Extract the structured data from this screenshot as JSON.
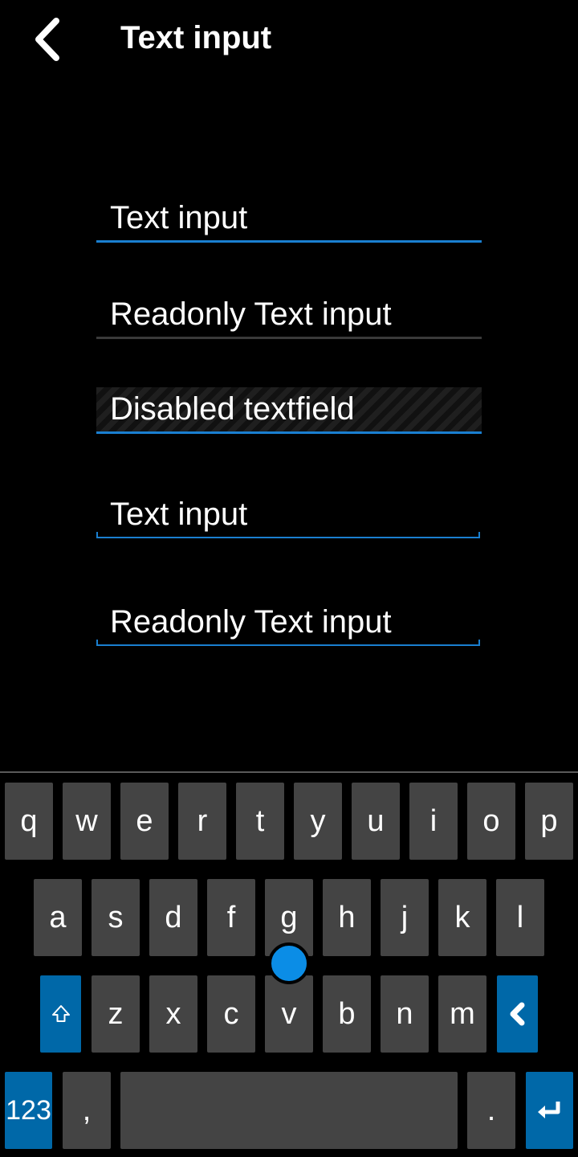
{
  "header": {
    "title": "Text input",
    "back_icon": "chevron-left-icon"
  },
  "fields": [
    {
      "value": "Text input",
      "state": "editable"
    },
    {
      "value": "Readonly Text input",
      "state": "readonly"
    },
    {
      "value": "Disabled textfield",
      "state": "disabled"
    },
    {
      "value": "Text input",
      "state": "editable"
    },
    {
      "value": "Readonly Text input",
      "state": "readonly"
    }
  ],
  "keyboard": {
    "row1": [
      "q",
      "w",
      "e",
      "r",
      "t",
      "y",
      "u",
      "i",
      "o",
      "p"
    ],
    "row2": [
      "a",
      "s",
      "d",
      "f",
      "g",
      "h",
      "j",
      "k",
      "l"
    ],
    "row3": [
      "z",
      "x",
      "c",
      "v",
      "b",
      "n",
      "m"
    ],
    "numbers_label": "123",
    "comma_label": ",",
    "period_label": ".",
    "shift_icon": "shift-icon",
    "backspace_icon": "backspace-icon",
    "enter_icon": "enter-icon",
    "accent_color": "#0068a8",
    "key_color": "#444444",
    "handle_color": "#0b8de6"
  }
}
